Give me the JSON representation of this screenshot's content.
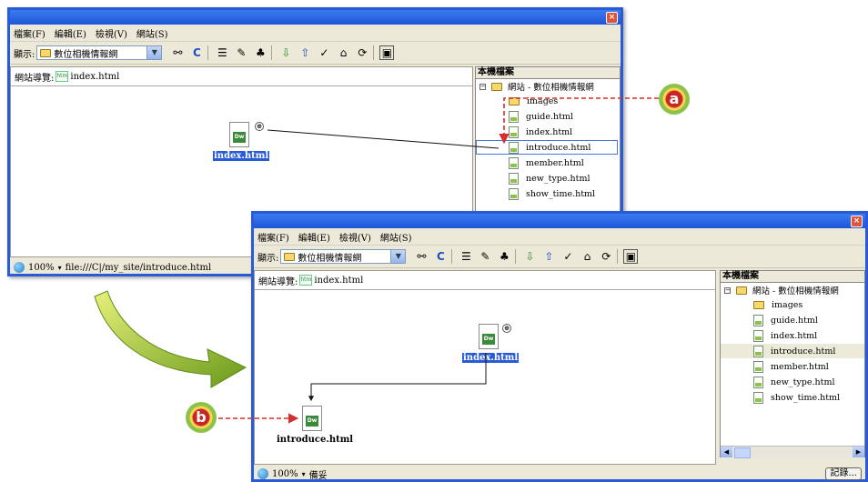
{
  "menu": {
    "file": "檔案(F)",
    "edit": "編輯(E)",
    "view": "檢視(V)",
    "site": "網站(S)"
  },
  "toolbar": {
    "show_label": "顯示:",
    "site_select": "數位相機情報網"
  },
  "panel": {
    "path_label": "網站導覽:",
    "path_file": "index.html",
    "files_header": "本機檔案"
  },
  "tree": {
    "root": "網站 - 數位相機情報網",
    "items": [
      "images",
      "guide.html",
      "index.html",
      "introduce.html",
      "member.html",
      "new_type.html",
      "show_time.html"
    ]
  },
  "nodes": {
    "index": "index.html",
    "introduce": "introduce.html",
    "dw_badge": "Dw"
  },
  "status": {
    "zoom1": "100%",
    "url": "file:///C|/my_site/introduce.html",
    "zoom2": "100%",
    "ready": "備妥",
    "log_button": "記錄..."
  },
  "callouts": {
    "a": "a",
    "b": "b"
  },
  "colors": {
    "titlebar": "#2a5bd7",
    "arrow_red": "#d32f2f",
    "callout_arrow": "#9acd32"
  }
}
